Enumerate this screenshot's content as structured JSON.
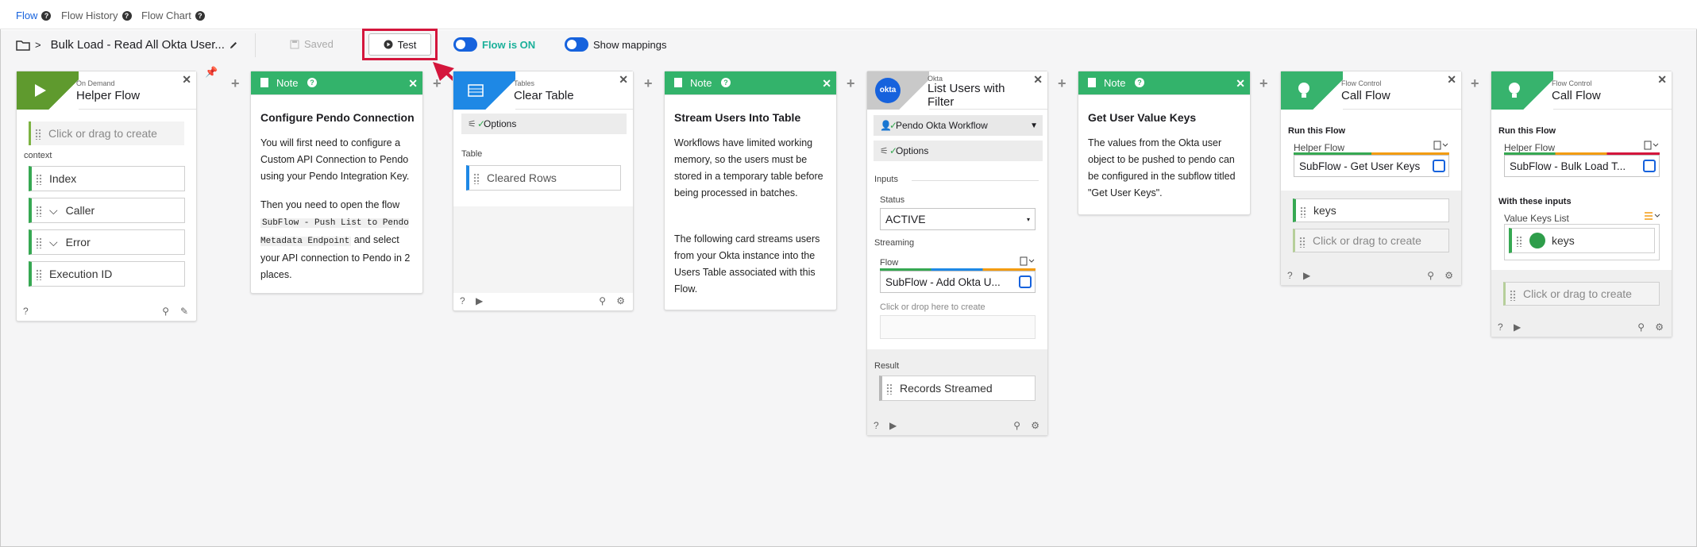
{
  "nav": {
    "tabs": [
      "Flow",
      "Flow History",
      "Flow Chart"
    ]
  },
  "toolbar": {
    "flow_name": "Bulk Load - Read All Okta User...",
    "saved_label": "Saved",
    "test_label": "Test",
    "flow_on_label": "Flow is ON",
    "show_mappings_label": "Show mappings"
  },
  "cards": {
    "helper": {
      "type": "On Demand",
      "title": "Helper Flow",
      "placeholder": "Click or drag to create",
      "context_label": "context",
      "fields": [
        "Index",
        "Caller",
        "Error",
        "Execution ID"
      ]
    },
    "note1": {
      "header": "Note",
      "title": "Configure Pendo Connection",
      "p1": "You will first need to configure a Custom API Connection to Pendo using your Pendo Integration Key.",
      "p2a": "Then you need to open the flow",
      "code": "SubFlow - Push List to Pendo Metadata Endpoint",
      "p2b": "and select your API connection to Pendo in 2 places."
    },
    "table": {
      "type": "Tables",
      "title": "Clear Table",
      "options": "Options",
      "table_label": "Table",
      "field": "Cleared Rows"
    },
    "note2": {
      "header": "Note",
      "title": "Stream Users Into Table",
      "p1": "Workflows have limited working memory, so the users must be stored in a temporary table before being processed in batches.",
      "p2": "The following card streams users from your Okta instance into the Users Table associated with this Flow."
    },
    "okta": {
      "type": "Okta",
      "title": "List Users with Filter",
      "logo": "okta",
      "connection": "Pendo Okta Workflow",
      "options": "Options",
      "inputs_label": "Inputs",
      "status_label": "Status",
      "status_value": "ACTIVE",
      "streaming_label": "Streaming",
      "flow_label": "Flow",
      "flow_value": "SubFlow - Add Okta U...",
      "drop_label": "Click or drop here to create",
      "result_label": "Result",
      "result_field": "Records Streamed"
    },
    "note3": {
      "header": "Note",
      "title": "Get User Value Keys",
      "p1": "The values from the Okta user object to be pushed to pendo can be configured in the subflow titled \"Get User Keys\"."
    },
    "call1": {
      "type": "Flow Control",
      "title": "Call Flow",
      "run_label": "Run this Flow",
      "helper_label": "Helper Flow",
      "helper_value": "SubFlow - Get User Keys",
      "out_field": "keys",
      "placeholder": "Click or drag to create"
    },
    "call2": {
      "type": "Flow Control",
      "title": "Call Flow",
      "run_label": "Run this Flow",
      "helper_label": "Helper Flow",
      "helper_value": "SubFlow - Bulk Load T...",
      "inputs_label": "With these inputs",
      "list_label": "Value Keys List",
      "in_field": "keys",
      "placeholder": "Click or drag to create"
    }
  },
  "colors": {
    "accent": "#1662dd",
    "note_green": "#33b36b",
    "highlight": "#d4163c",
    "field_green": "#36a852",
    "okta_blue": "#1662dd"
  }
}
